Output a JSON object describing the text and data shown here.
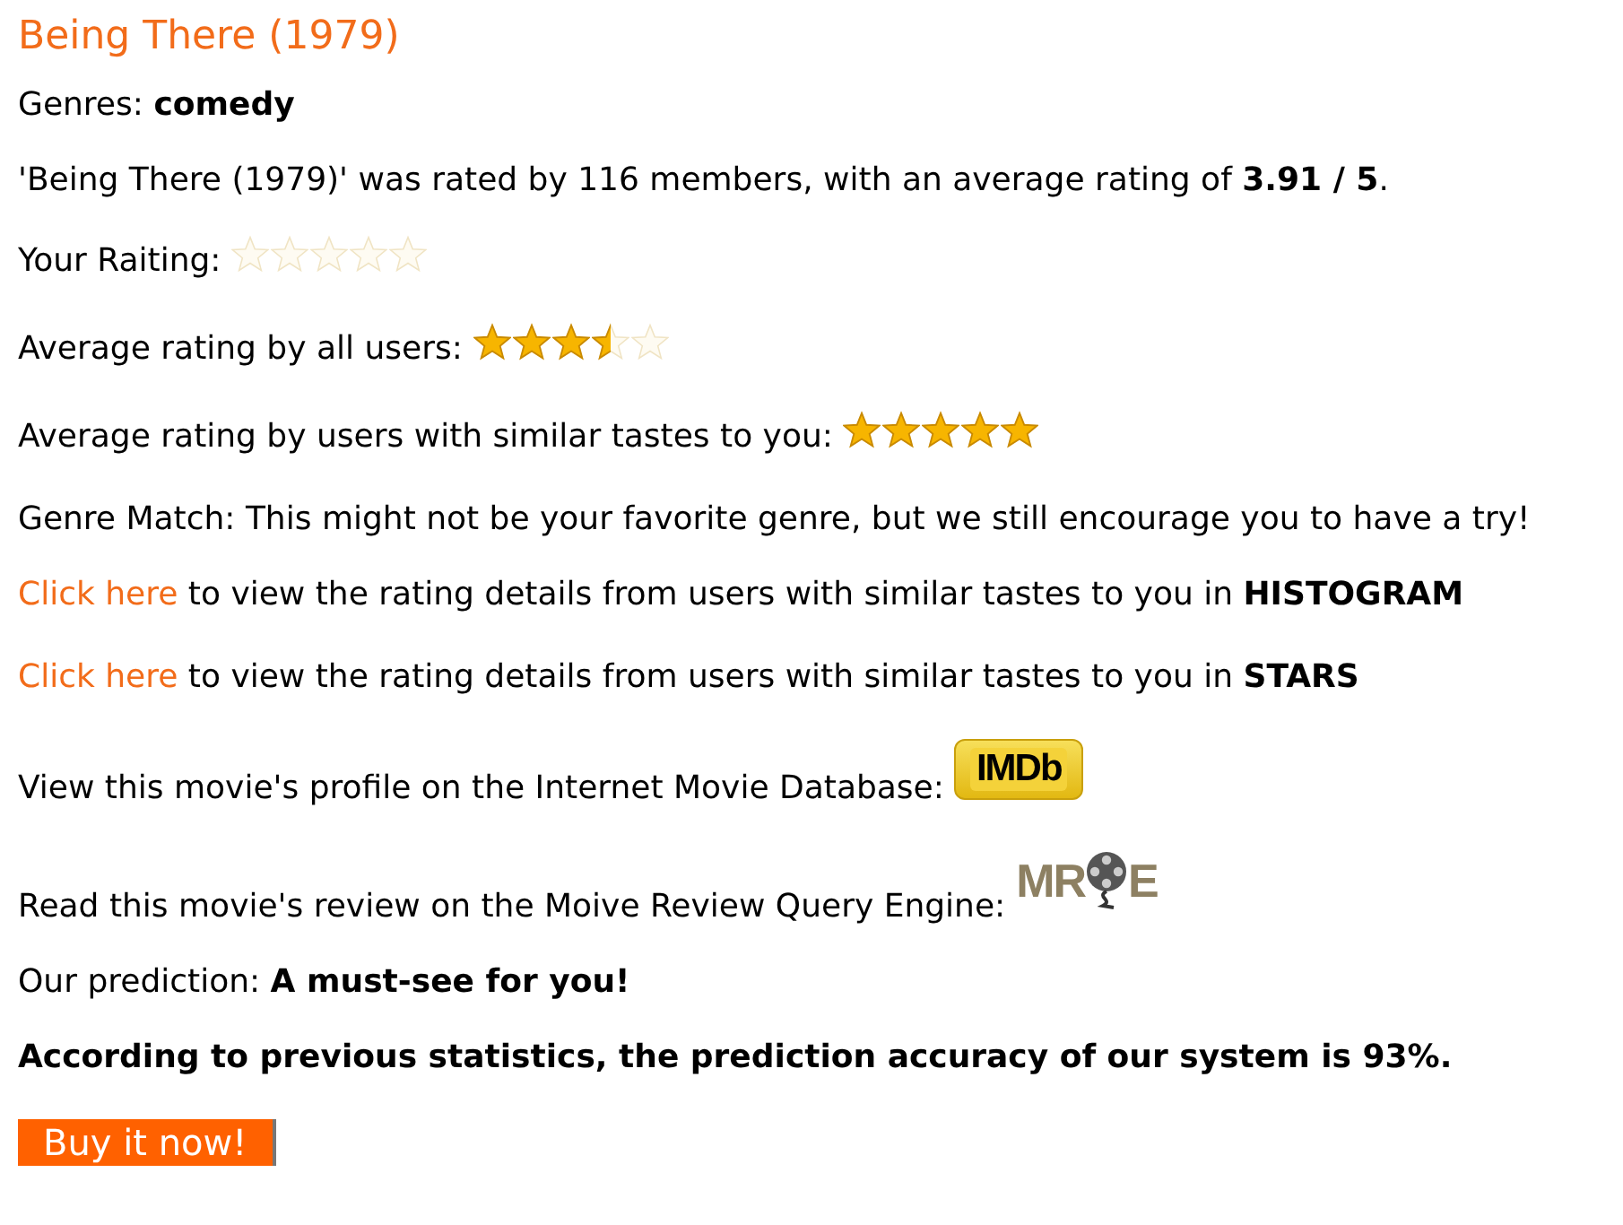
{
  "title": "Being There (1979)",
  "lines": [
    {
      "kind": "text",
      "text": "Genres: **comedy**"
    },
    {
      "kind": "text",
      "text": "'Being There (1979)' was rated by 116 members, with an average rating of **3.91 / 5**."
    },
    {
      "kind": "stars",
      "label": "Your Raiting:",
      "stars": 0
    },
    {
      "kind": "stars",
      "label": "Average rating by all users:",
      "stars": 3.5
    },
    {
      "kind": "stars",
      "label": "Average rating by users with similar tastes to you:",
      "stars": 5
    },
    {
      "kind": "text",
      "text": "Genre Match: This might not be your favorite genre, but we still encourage you to have a try!"
    },
    {
      "kind": "link",
      "link": "Click here",
      "text": " to view the rating details from users with similar tastes to you in **HISTOGRAM**"
    },
    {
      "kind": "link",
      "link": "Click here",
      "text": " to view the rating details from users with similar tastes to you in **STARS**"
    },
    {
      "kind": "imdb",
      "text": "View this movie's profile on the Internet Movie Database:",
      "logo": "IMDb"
    },
    {
      "kind": "mrqe",
      "text": "Read this movie's review on the Moive Review Query Engine:",
      "logo_left": "MR",
      "logo_right": "E"
    },
    {
      "kind": "text",
      "text": "Our prediction: **A must-see for you!**"
    },
    {
      "kind": "bold",
      "text": "According to previous statistics, the prediction accuracy of our system is 93%."
    }
  ],
  "button": "Buy it now!"
}
